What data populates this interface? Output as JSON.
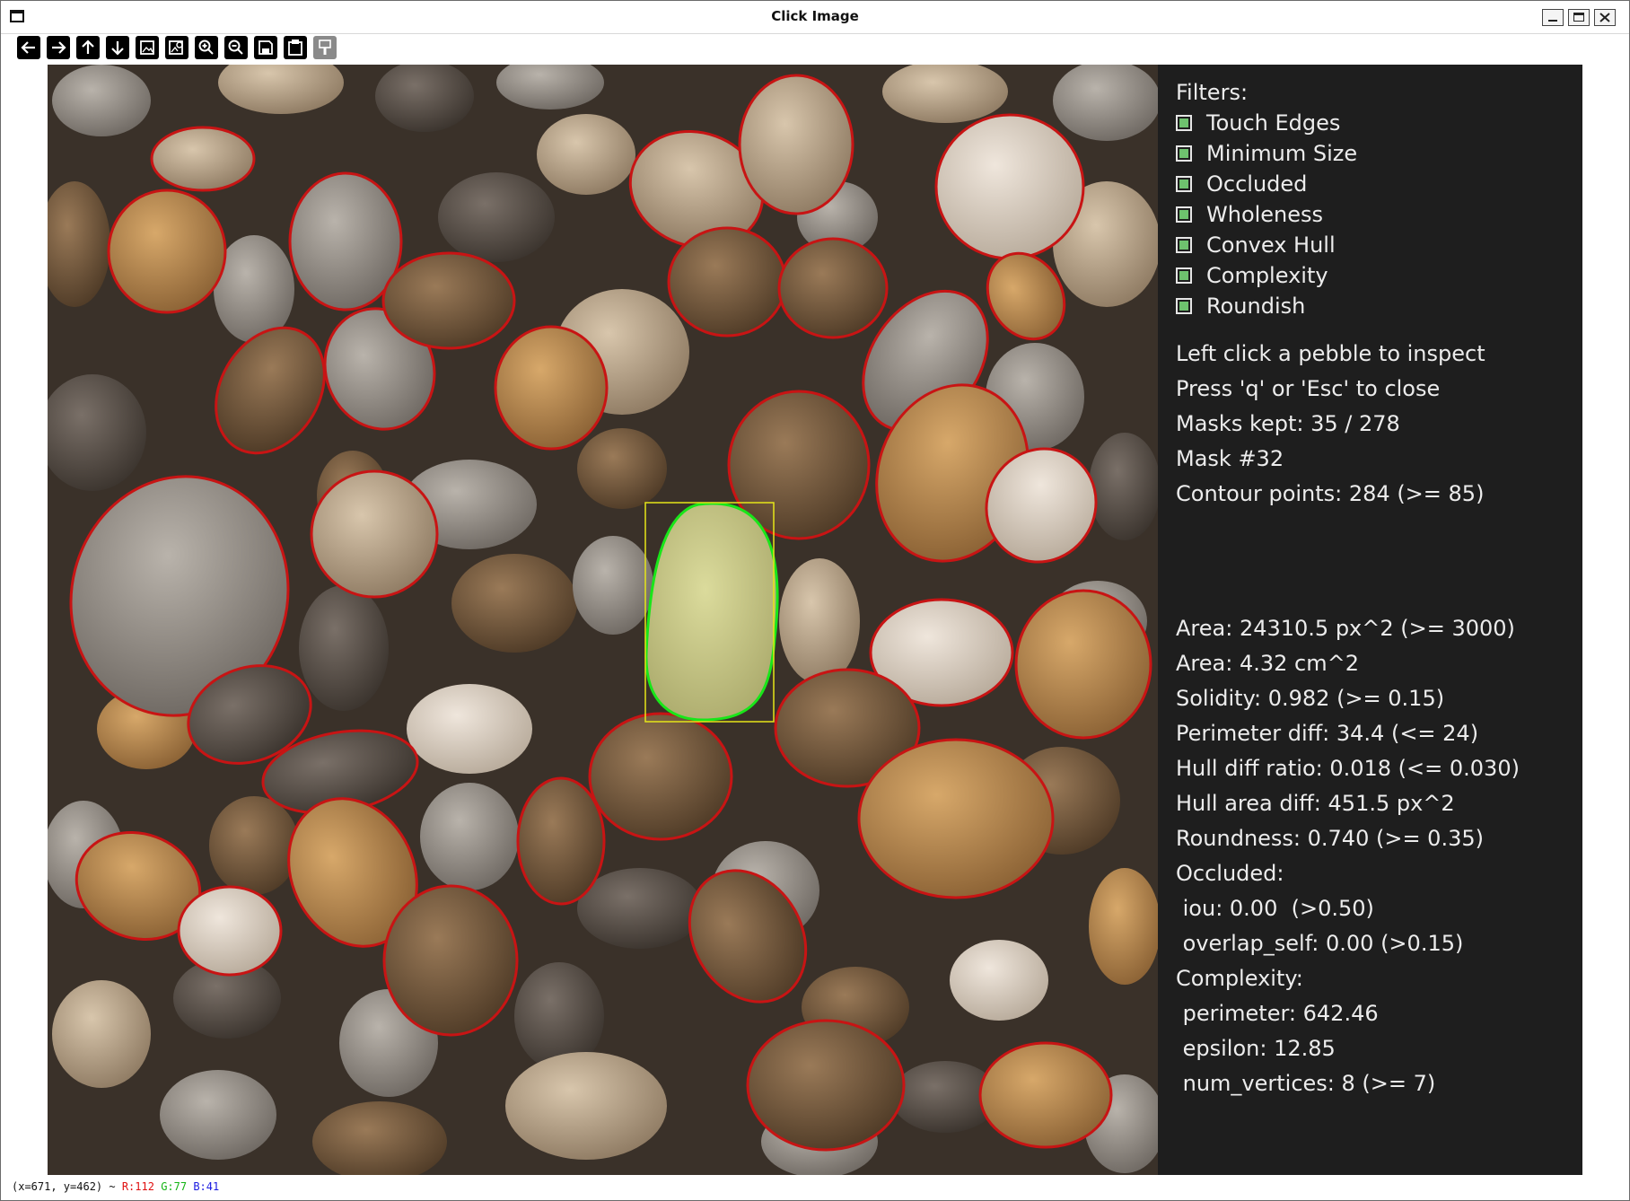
{
  "window": {
    "title": "Click Image"
  },
  "toolbar": {
    "buttons": [
      {
        "name": "back-button",
        "icon": "arrow-left-icon"
      },
      {
        "name": "forward-button",
        "icon": "arrow-right-icon"
      },
      {
        "name": "up-button",
        "icon": "arrow-up-icon"
      },
      {
        "name": "down-button",
        "icon": "arrow-down-icon"
      },
      {
        "name": "zoom-fit-button",
        "icon": "image-icon"
      },
      {
        "name": "zoom-original-button",
        "icon": "image-magnify-icon"
      },
      {
        "name": "zoom-in-button",
        "icon": "zoom-in-icon"
      },
      {
        "name": "zoom-out-button",
        "icon": "zoom-out-icon"
      },
      {
        "name": "save-button",
        "icon": "floppy-icon"
      },
      {
        "name": "copy-button",
        "icon": "clipboard-icon"
      },
      {
        "name": "properties-button",
        "icon": "brush-icon"
      }
    ]
  },
  "panel": {
    "filters_title": "Filters:",
    "filters": [
      {
        "label": "Touch Edges",
        "checked": true
      },
      {
        "label": "Minimum Size",
        "checked": true
      },
      {
        "label": "Occluded",
        "checked": true
      },
      {
        "label": "Wholeness",
        "checked": true
      },
      {
        "label": "Convex Hull",
        "checked": true
      },
      {
        "label": "Complexity",
        "checked": true
      },
      {
        "label": "Roundish",
        "checked": true
      }
    ],
    "instructions": [
      "Left click a pebble to inspect",
      "Press 'q' or 'Esc' to close",
      "Masks kept: 35 / 278",
      "Mask #32",
      "Contour points: 284 (>= 85)"
    ],
    "metrics": [
      "Area: 24310.5 px^2 (>= 3000)",
      "Area: 4.32 cm^2",
      "Solidity: 0.982 (>= 0.15)",
      "Perimeter diff: 34.4 (<= 24)",
      "Hull diff ratio: 0.018 (<= 0.030)",
      "Hull area diff: 451.5 px^2",
      "Roundness: 0.740 (>= 0.35)",
      "Occluded:",
      " iou: 0.00  (>0.50)",
      " overlap_self: 0.00 (>0.15)",
      "Complexity:",
      " perimeter: 642.46",
      " epsilon: 12.85",
      " num_vertices: 8 (>= 7)"
    ]
  },
  "status": {
    "coords": "(x=671, y=462) ~ ",
    "r": "R:112",
    "g": "G:77",
    "b": "B:41"
  },
  "colors": {
    "kept_contour": "#c81414",
    "selected_contour": "#19e619",
    "selected_bbox": "#e6e619",
    "panel_bg": "#1e1e1e",
    "checkbox_fill": "#6ec26e"
  }
}
